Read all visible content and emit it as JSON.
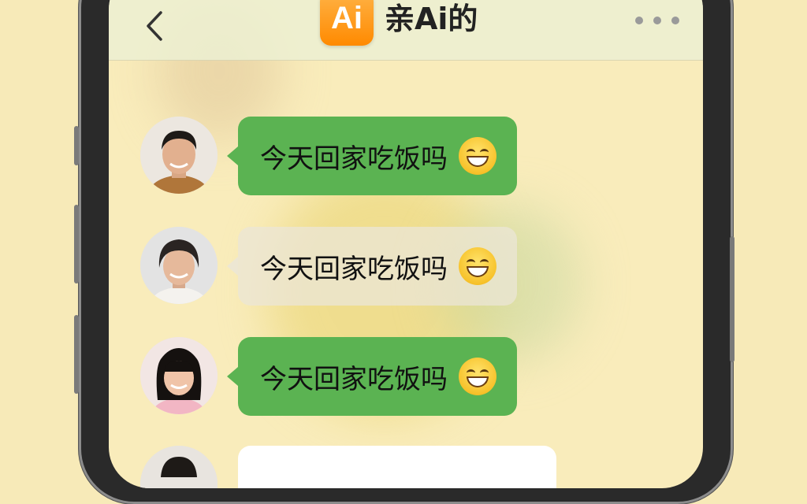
{
  "header": {
    "back_icon": "chevron-left-icon",
    "logo_text": "Ai",
    "title": "亲Ai的",
    "more_icon": "more-dots-icon"
  },
  "messages": [
    {
      "text": "今天回家吃饭吗",
      "emoji": "grinning-face-icon",
      "style": "green",
      "avatar": "man-avatar"
    },
    {
      "text": "今天回家吃饭吗",
      "emoji": "grinning-face-icon",
      "style": "glass",
      "avatar": "older-woman-avatar"
    },
    {
      "text": "今天回家吃饭吗",
      "emoji": "grinning-face-icon",
      "style": "green",
      "avatar": "girl-avatar"
    },
    {
      "text": "",
      "style": "white",
      "avatar": "avatar"
    }
  ],
  "colors": {
    "background": "#f7eab8",
    "bubble_green": "#5bb352",
    "logo_orange": "#ff9a1f",
    "title_text": "#222222"
  }
}
